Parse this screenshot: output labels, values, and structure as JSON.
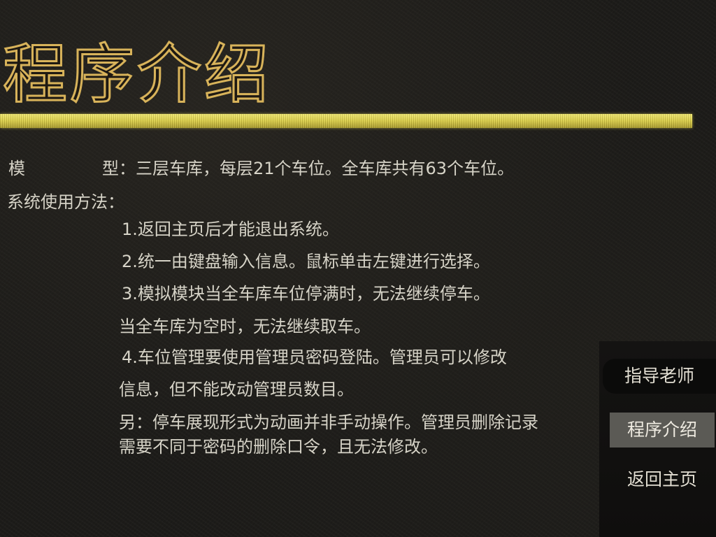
{
  "header": {
    "title": "程序介绍"
  },
  "content": {
    "model_label_a": "模",
    "model_label_b": "型：三层车库，每层21个车位。全车库共有63个车位。",
    "usage_label": "系统使用方法：",
    "items": [
      "1.返回主页后才能退出系统。",
      "2.统一由键盘输入信息。鼠标单击左键进行选择。",
      "3.模拟模块当全车库车位停满时，无法继续停车。",
      "当全车库为空时，无法继续取车。",
      "4.车位管理要使用管理员密码登陆。管理员可以修改",
      "信息，但不能改动管理员数目。",
      "另：停车展现形式为动画并非手动操作。管理员删除记录",
      "需要不同于密码的删除口令，且无法修改。"
    ]
  },
  "nav": {
    "teacher": "指导老师",
    "intro": "程序介绍",
    "home": "返回主页"
  },
  "colors": {
    "title_outline": "#d8b35a",
    "title_bar": "#e3d85a",
    "text": "#d6d3c7",
    "nav_active_bg": "#5b5a55"
  }
}
